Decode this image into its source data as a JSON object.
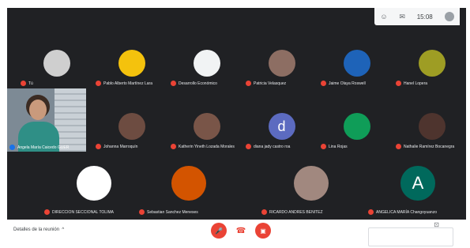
{
  "topbar": {
    "time": "15:08"
  },
  "participants": [
    {
      "name": "Tú",
      "initial": "",
      "color": "#cfcfcf"
    },
    {
      "name": "Pablo Alberto Martínez Lara",
      "initial": "",
      "color": "#f4c20d"
    },
    {
      "name": "Desarrollo Económico",
      "initial": "",
      "color": "#f1f3f4"
    },
    {
      "name": "Patricia Velasquez",
      "initial": "",
      "color": "#8d6e63"
    },
    {
      "name": "Jaime Olaya Roswell",
      "initial": "",
      "color": "#1e63b8"
    },
    {
      "name": "Hanel Lopera",
      "initial": "",
      "color": "#9e9d24"
    },
    {
      "name": "Johanna Marroquín",
      "initial": "",
      "color": "#6d4c41"
    },
    {
      "name": "Katherin Yineth Lozada Morales",
      "initial": "",
      "color": "#795548"
    },
    {
      "name": "diana jady castro roa",
      "initial": "d",
      "color": "#5c6bc0"
    },
    {
      "name": "Lina Rojas",
      "initial": "",
      "color": "#0f9d58"
    },
    {
      "name": "Nathalie Ramírez Bocanegra",
      "initial": "",
      "color": "#4e342e"
    },
    {
      "name": "DIRECCION SECCIONAL TOLIMA",
      "initial": "",
      "color": "#ffffff"
    },
    {
      "name": "Sebastian Sanchez Meneses",
      "initial": "",
      "color": "#d35400"
    },
    {
      "name": "RICARDO ANDRES BENITEZ",
      "initial": "",
      "color": "#a1887f"
    },
    {
      "name": "ANGELICA MARÍA Changoyuanzo",
      "initial": "A",
      "color": "#00695c"
    }
  ],
  "self_view": {
    "name": "Angela María Caicedo GUER"
  },
  "bottombar": {
    "meeting_details": "Detalles de la reunión"
  },
  "colors": {
    "end_call": "#ea4335",
    "background": "#202124"
  }
}
